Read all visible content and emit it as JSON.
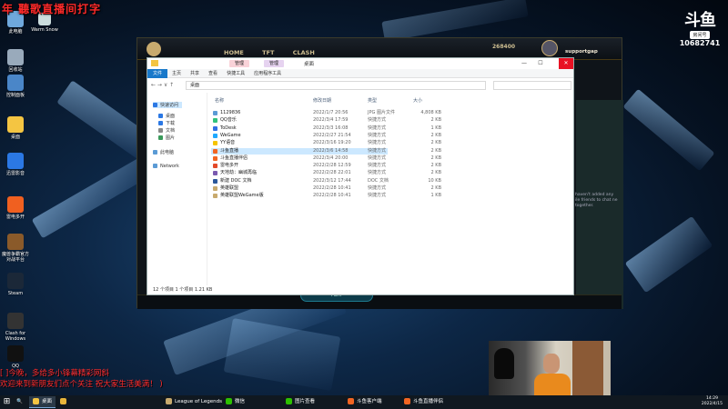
{
  "overlay": {
    "top_title": "年 聽歌直播间打字",
    "bottom_line1": "[ ]今晚，多给多小锋幕精彩网斜",
    "bottom_line2": "欢迎来到新朋友们点个关注 祝大家生活美满！ )"
  },
  "watermark": {
    "logo": "斗鱼",
    "room_label": "房间号",
    "room_number": "10682741"
  },
  "desktop_icons": [
    {
      "label": "此电脑",
      "color": "#6fa8dc"
    },
    {
      "label": "回收站",
      "color": "#9ab"
    },
    {
      "label": "控制面板",
      "color": "#4a86c8"
    },
    {
      "label": "桌面",
      "color": "#f4c542"
    },
    {
      "label": "迅雷影音",
      "color": "#2b78e4"
    },
    {
      "label": "雷电多开",
      "color": "#f06020"
    },
    {
      "label": "魔兽争霸官方对战平台",
      "color": "#8a5a2a"
    },
    {
      "label": "Steam",
      "color": "#1b2838"
    },
    {
      "label": "Clash for Windows",
      "color": "#333"
    },
    {
      "label": "QQ",
      "color": "#111"
    }
  ],
  "desktop_top_icons": [
    {
      "label": "Warm Snow",
      "color": "#cdd"
    }
  ],
  "lol": {
    "nav": [
      "HOME",
      "TFT",
      "CLASH"
    ],
    "currency": "268400",
    "username": "supportgap",
    "play_button": "PLAY",
    "friends_text": "haven't added any ile friends to chat ne together."
  },
  "explorer": {
    "title": "桌面",
    "context_tabs": [
      "管理",
      "管理"
    ],
    "ribbon_tabs": [
      "文件",
      "主页",
      "共享",
      "查看",
      "快捷工具",
      "应用程序工具"
    ],
    "address": "桌面",
    "nav_items": [
      "快速访问",
      "桌面",
      "下载",
      "文档",
      "图片",
      "此电脑",
      "Network"
    ],
    "columns": {
      "name": "名称",
      "date": "修改日期",
      "type": "类型",
      "size": "大小"
    },
    "files": [
      {
        "name": "1129836",
        "date": "2022/1/7 20:56",
        "type": "JPG 图片文件",
        "size": "4,808 KB",
        "color": "#5b9bd5"
      },
      {
        "name": "QQ音乐",
        "date": "2022/3/4 17:59",
        "type": "快捷方式",
        "size": "2 KB",
        "color": "#31c27c"
      },
      {
        "name": "ToDesk",
        "date": "2022/3/3 16:08",
        "type": "快捷方式",
        "size": "1 KB",
        "color": "#2f6fe4"
      },
      {
        "name": "WeGame",
        "date": "2022/2/27 21:54",
        "type": "快捷方式",
        "size": "2 KB",
        "color": "#1fa9ff"
      },
      {
        "name": "YY语音",
        "date": "2022/3/16 19:20",
        "type": "快捷方式",
        "size": "2 KB",
        "color": "#f5c400"
      },
      {
        "name": "斗鱼直播",
        "date": "2022/3/6 14:58",
        "type": "快捷方式",
        "size": "2 KB",
        "color": "#f26522"
      },
      {
        "name": "斗鱼直播伴侣",
        "date": "2022/3/4 20:00",
        "type": "快捷方式",
        "size": "2 KB",
        "color": "#f26522"
      },
      {
        "name": "雷电多开",
        "date": "2022/2/28 12:59",
        "type": "快捷方式",
        "size": "2 KB",
        "color": "#e34a2a"
      },
      {
        "name": "天地劫：幽城再临",
        "date": "2022/2/28 22:01",
        "type": "快捷方式",
        "size": "2 KB",
        "color": "#7a5ab0"
      },
      {
        "name": "新建 DOC 文档",
        "date": "2022/3/12 17:44",
        "type": "DOC 文档",
        "size": "10 KB",
        "color": "#2b579a"
      },
      {
        "name": "英雄联盟",
        "date": "2022/2/28 10:41",
        "type": "快捷方式",
        "size": "2 KB",
        "color": "#c8aa6e"
      },
      {
        "name": "英雄联盟WeGame版",
        "date": "2022/2/28 10:41",
        "type": "快捷方式",
        "size": "1 KB",
        "color": "#c8aa6e"
      }
    ],
    "status": "12 个项目    1 个项目 1.21 KB"
  },
  "taskbar": {
    "items": [
      {
        "label": "桌面",
        "active": true,
        "color": "#f4c542"
      },
      {
        "label": "",
        "active": false,
        "color": "#e8b53a"
      },
      {
        "label": "League of Legends",
        "active": false,
        "color": "#c8aa6e"
      },
      {
        "label": "微信",
        "active": false,
        "color": "#2dc100"
      },
      {
        "label": "图片查看",
        "active": false,
        "color": "#2dc100"
      },
      {
        "label": "斗鱼客户端",
        "active": false,
        "color": "#f26522"
      },
      {
        "label": "斗鱼直播伴侣",
        "active": false,
        "color": "#f26522"
      }
    ],
    "time": "14:29",
    "date": "2022/4/15"
  }
}
